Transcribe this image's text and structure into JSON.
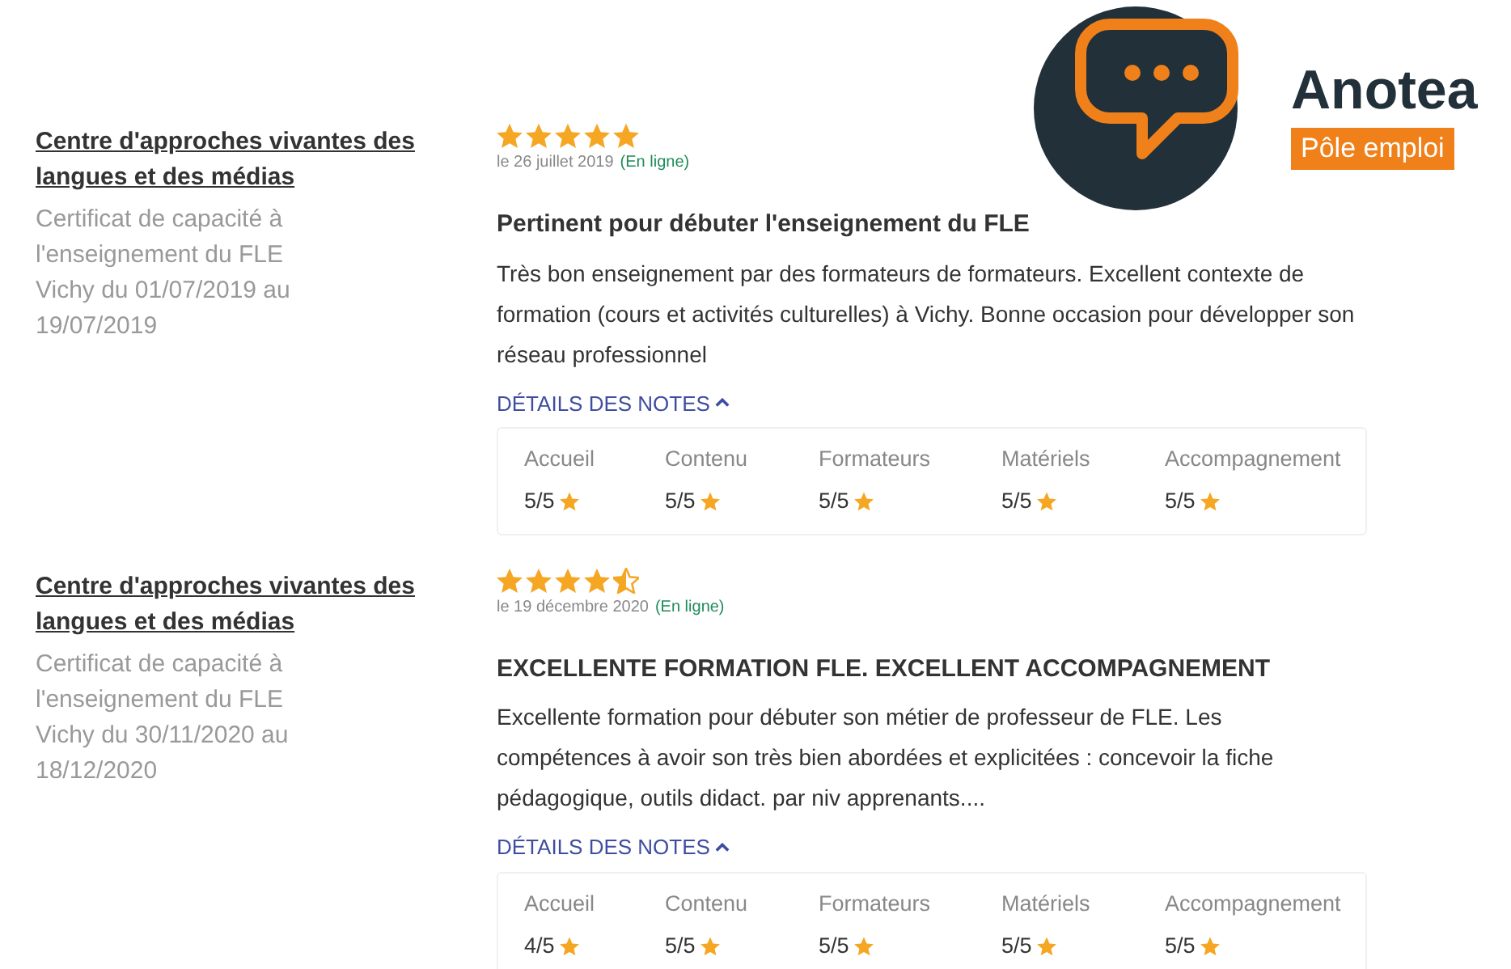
{
  "logo": {
    "name": "Anotea",
    "tagline": "Pôle emploi"
  },
  "reviews": [
    {
      "organism": "Centre d'approches vivantes des langues et des médias",
      "training": [
        "Certificat de capacité à",
        "l'enseignement du FLE",
        "Vichy du 01/07/2019 au",
        "19/07/2019"
      ],
      "stars": 5,
      "date": "le 26 juillet 2019",
      "mode": "(En ligne)",
      "title": "Pertinent pour débuter l'enseignement du FLE",
      "comment": "Très bon enseignement par des formateurs de formateurs. Excellent contexte de formation (cours et activités culturelles) à Vichy. Bonne occasion pour développer son réseau professionnel",
      "details_label": "DÉTAILS DES NOTES",
      "expanded": true,
      "notes": [
        {
          "label": "Accueil",
          "value": "5/5"
        },
        {
          "label": "Contenu",
          "value": "5/5"
        },
        {
          "label": "Formateurs",
          "value": "5/5"
        },
        {
          "label": "Matériels",
          "value": "5/5"
        },
        {
          "label": "Accompagnement",
          "value": "5/5"
        }
      ]
    },
    {
      "organism": "Centre d'approches vivantes des langues et des médias",
      "training": [
        "Certificat de capacité à",
        "l'enseignement du FLE",
        "Vichy du 30/11/2020 au",
        "18/12/2020"
      ],
      "stars": 4.5,
      "date": "le 19 décembre 2020",
      "mode": "(En ligne)",
      "title": "EXCELLENTE FORMATION FLE. EXCELLENT ACCOMPAGNEMENT",
      "comment": "Excellente formation pour débuter son métier de professeur de FLE. Les compétences à avoir son très bien abordées et explicitées : concevoir la fiche pédagogique, outils didact. par niv apprenants....",
      "details_label": "DÉTAILS DES NOTES",
      "expanded": true,
      "notes": [
        {
          "label": "Accueil",
          "value": "4/5"
        },
        {
          "label": "Contenu",
          "value": "5/5"
        },
        {
          "label": "Formateurs",
          "value": "5/5"
        },
        {
          "label": "Matériels",
          "value": "5/5"
        },
        {
          "label": "Accompagnement",
          "value": "5/5"
        }
      ]
    }
  ]
}
